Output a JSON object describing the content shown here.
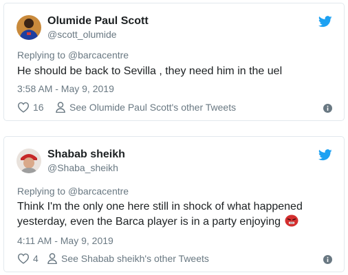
{
  "colors": {
    "twitter_blue": "#1da1f2",
    "secondary_text": "#697882",
    "primary_text": "#1c2022",
    "border": "#e1e8ed"
  },
  "tweets": [
    {
      "name": "Olumide Paul Scott",
      "handle": "@scott_olumide",
      "replying_prefix": "Replying to ",
      "replying_to": "@barcacentre",
      "text": "He should be back to Sevilla , they need him in the uel",
      "time": "3:58 AM - May 9, 2019",
      "likes": "16",
      "other_tweets": "See Olumide Paul Scott's other Tweets",
      "icons": {
        "like": "heart-icon",
        "profile": "person-icon",
        "info": "info-icon",
        "brand": "twitter-bird-icon"
      }
    },
    {
      "name": "Shabab sheikh",
      "handle": "@Shaba_sheikh",
      "replying_prefix": "Replying to ",
      "replying_to": "@barcacentre",
      "text_line1": "Think I'm the only one here still in shock of what happened",
      "text_line2": "yesterday, even the Barca player is in a party enjoying",
      "emoji": "angry-face-emoji",
      "time": "4:11 AM - May 9, 2019",
      "likes": "4",
      "other_tweets": "See Shabab sheikh's other Tweets",
      "icons": {
        "like": "heart-icon",
        "profile": "person-icon",
        "info": "info-icon",
        "brand": "twitter-bird-icon"
      }
    }
  ]
}
